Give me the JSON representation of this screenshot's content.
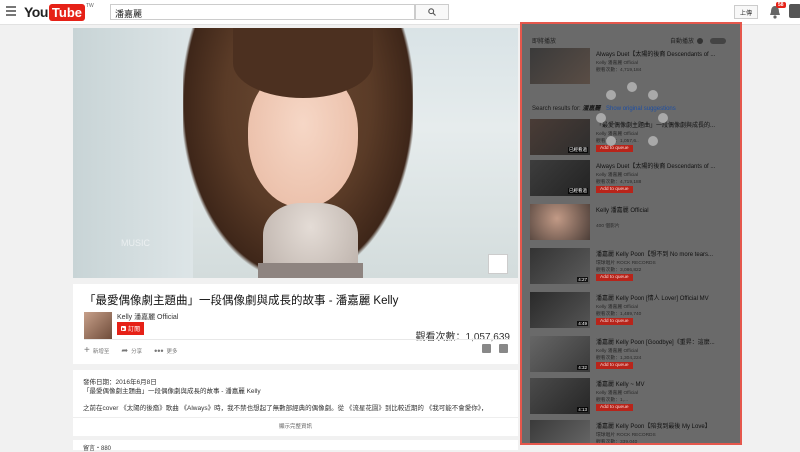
{
  "header": {
    "logo_you": "You",
    "logo_tube": "Tube",
    "logo_region": "TW",
    "search_value": "潘嘉麗",
    "upload_label": "上傳",
    "notification_count": "58"
  },
  "video": {
    "watermark": "MUSIC",
    "title": "「最愛偶像劇主題曲」一段偶像劇與成長的故事 - 潘嘉麗 Kelly",
    "channel": "Kelly 潘嘉麗 Official",
    "subscribe_label": "訂閱",
    "views": "觀看次數：1,057,639",
    "actions": {
      "add": "新增至",
      "share": "分享",
      "more": "更多"
    }
  },
  "description": {
    "date": "發佈日期：2016年6月8日",
    "line1": "「最愛偶像劇主題曲」一段偶像劇與成長的故事 - 潘嘉麗 Kelly",
    "line2": "之前在cover 《太陽的後裔》歌曲 《Always》時，我不禁也想起了無數部經典的偶像劇。從 《流星花園》到比較近期的 《我可能不會愛你》，",
    "show_more": "顯示完整資訊"
  },
  "comments": {
    "label": "留言・880"
  },
  "sidebar": {
    "header": "即將播放",
    "autoplay_label": "自動播放",
    "next": {
      "title": "Always Duet【太陽的後裔 Descendants of ...",
      "channel": "Kelly 潘嘉麗 Official",
      "views": "觀看次數：4,719,184"
    },
    "search_results_prefix": "Search results for:",
    "search_query": "潘嘉麗",
    "show_original": "Show original suggestions",
    "items": [
      {
        "title": "「最愛偶像劇主題曲」一段偶像劇與成長的...",
        "channel": "Kelly 潘嘉麗 Official",
        "views": "觀看次數：1,057,6..",
        "queue": "Add to queue",
        "badge": "已經看過",
        "duration": ""
      },
      {
        "title": "Always Duet【太陽的後裔 Descendants of ...",
        "channel": "Kelly 潘嘉麗 Official",
        "views": "觀看次數：4,719,188",
        "queue": "Add to queue",
        "badge": "已經看過",
        "duration": ""
      },
      {
        "title": "Kelly 潘嘉麗 Official",
        "channel": "",
        "views": "400 個影片",
        "queue": "",
        "badge": "",
        "duration": ""
      },
      {
        "title": "潘嘉麗 Kelly Poon【想不到 No more tears...",
        "channel": "環球唱片 ROCK RECORDS",
        "views": "觀看次數：3,086,822",
        "queue": "Add to queue",
        "badge": "",
        "duration": "4:27"
      },
      {
        "title": "潘嘉麗 Kelly Poon [情人 Lover] Official MV",
        "channel": "Kelly 潘嘉麗 Official",
        "views": "觀看次數：1,489,740",
        "queue": "Add to queue",
        "badge": "",
        "duration": "4:49"
      },
      {
        "title": "潘嘉麗 Kelly Poon [Goodbye]《重昇：這麼...",
        "channel": "Kelly 潘嘉麗 Official",
        "views": "觀看次數：1,304,224",
        "queue": "Add to queue",
        "badge": "",
        "duration": "4:32"
      },
      {
        "title": "潘嘉麗 Kelly ~ MV",
        "channel": "Kelly 潘嘉麗 Official",
        "views": "觀看次數：1,...",
        "queue": "Add to queue",
        "badge": "",
        "duration": "4:13"
      },
      {
        "title": "潘嘉麗 Kelly Poon【陪我到最後 My Love】",
        "channel": "環球唱片 ROCK RECORDS",
        "views": "觀看次數：339,040",
        "queue": "",
        "badge": "",
        "duration": ""
      }
    ]
  }
}
